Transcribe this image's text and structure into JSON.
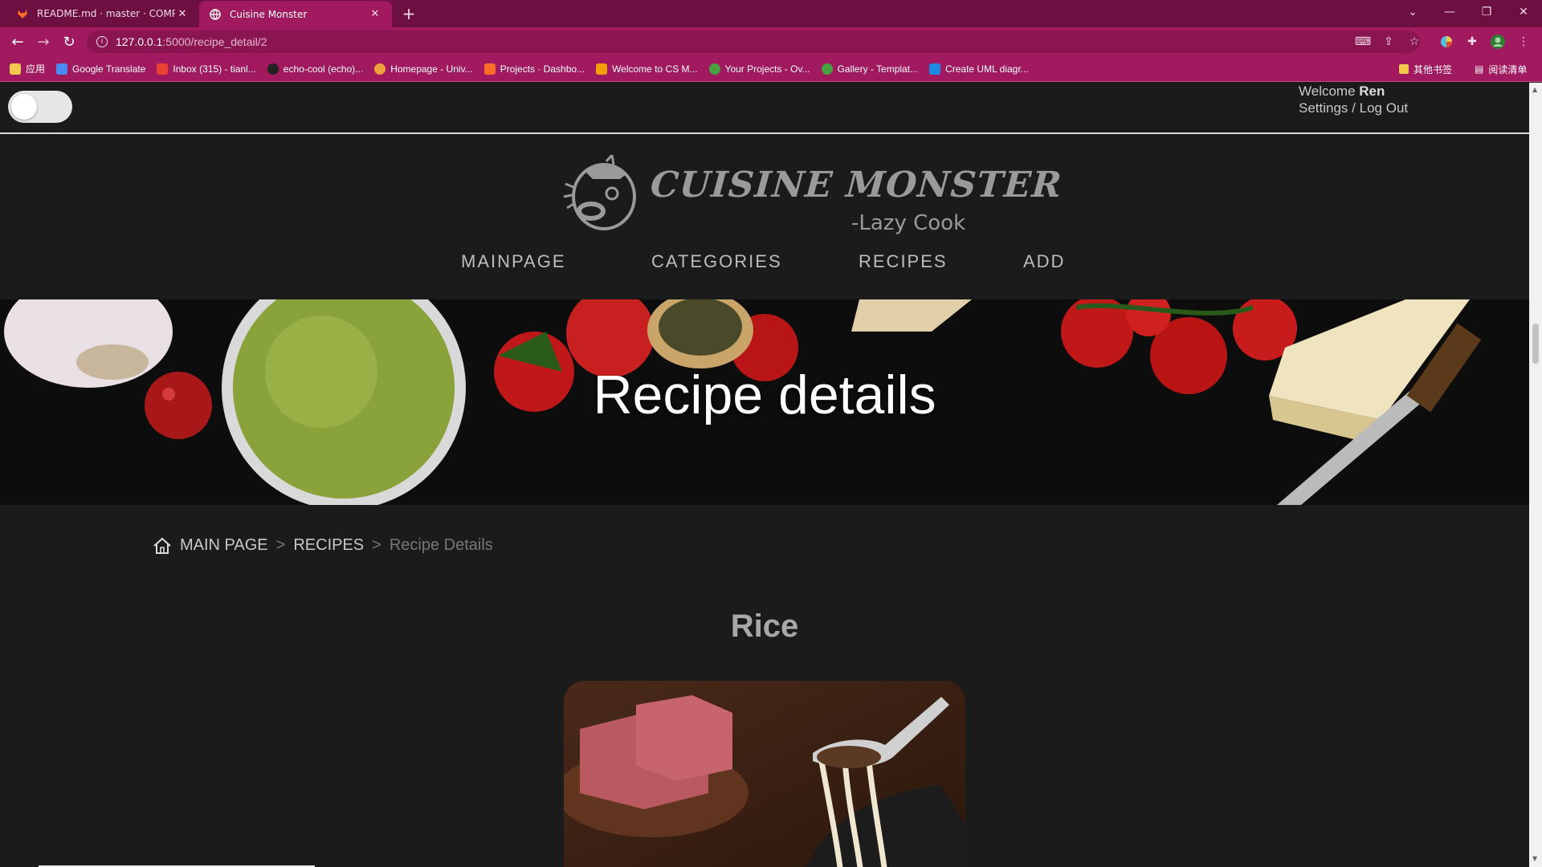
{
  "browser": {
    "tabs": [
      {
        "title": "README.md · master · COMP3",
        "favicon": "gitlab-icon",
        "active": false
      },
      {
        "title": "Cuisine Monster",
        "favicon": "globe-icon",
        "active": true
      }
    ],
    "url_host": "127.0.0.1",
    "url_path": ":5000/recipe_detail/2",
    "bookmarks": [
      {
        "label": "应用",
        "icon": "apps-icon",
        "color": "#f2c94c"
      },
      {
        "label": "Google Translate",
        "icon": "translate-icon",
        "color": "#4a8af4"
      },
      {
        "label": "Inbox (315) - tianl...",
        "icon": "gmail-icon",
        "color": "#ea4335"
      },
      {
        "label": "echo-cool (echo)...",
        "icon": "github-icon",
        "color": "#222222"
      },
      {
        "label": "Homepage - Univ...",
        "icon": "univ-icon",
        "color": "#f0a03c"
      },
      {
        "label": "Projects · Dashbo...",
        "icon": "gitlab-icon",
        "color": "#fc6d26"
      },
      {
        "label": "Welcome to CS M...",
        "icon": "cs-icon",
        "color": "#f59e0b"
      },
      {
        "label": "Your Projects - Ov...",
        "icon": "overleaf-icon",
        "color": "#47a141"
      },
      {
        "label": "Gallery - Templat...",
        "icon": "overleaf-icon",
        "color": "#47a141"
      },
      {
        "label": "Create UML diagr...",
        "icon": "uml-icon",
        "color": "#1e88e5"
      }
    ],
    "other_bookmarks": "其他书签",
    "reading_list": "阅读清单"
  },
  "header": {
    "welcome_prefix": "Welcome",
    "username": "Ren",
    "settings_label": "Settings",
    "divider": "/",
    "logout_label": "Log Out"
  },
  "logo": {
    "name": "CUISINE MONSTER",
    "tagline": "-Lazy Cook"
  },
  "nav": {
    "items": [
      "MAINPAGE",
      "CATEGORIES",
      "RECIPES",
      "ADD"
    ]
  },
  "hero": {
    "title": "Recipe details"
  },
  "breadcrumb": {
    "home": "MAIN PAGE",
    "sep": ">",
    "recipes": "RECIPES",
    "current": "Recipe Details"
  },
  "recipe": {
    "name": "Rice"
  }
}
